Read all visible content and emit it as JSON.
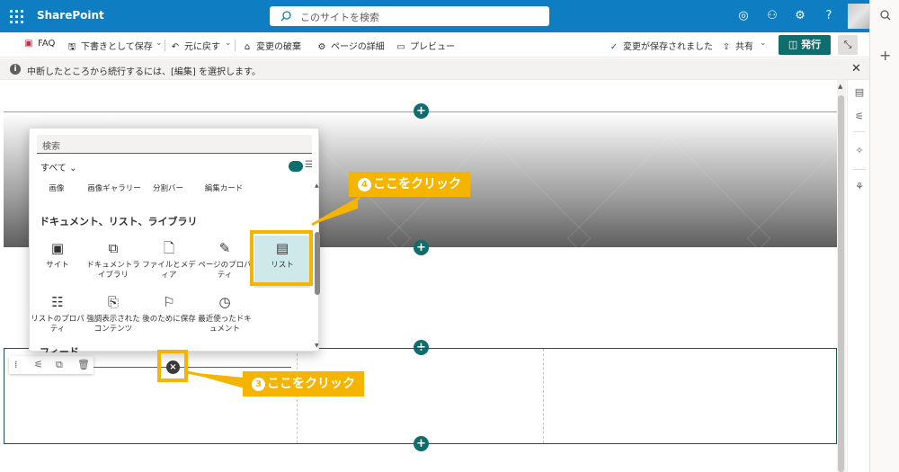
{
  "suitebar": {
    "app_title": "SharePoint",
    "search_placeholder": "このサイトを検索",
    "brand_color": "#0f7dc2"
  },
  "commandbar": {
    "faq": "FAQ",
    "save_draft": "下書きとして保存",
    "undo": "元に戻す",
    "discard": "変更の破棄",
    "page_details": "ページの詳細",
    "preview": "プレビュー",
    "saved_status": "変更が保存されました",
    "share": "共有",
    "publish": "発行",
    "publish_color": "#0e6e6e"
  },
  "infobar": {
    "message": "中断したところから続行するには、[編集] を選択します。"
  },
  "picker": {
    "search_placeholder": "検索",
    "filter_label": "すべて",
    "top_row": [
      "画像",
      "画像ギャラリー",
      "分割バー",
      "編集カード"
    ],
    "category_title": "ドキュメント、リスト、ライブラリ",
    "tiles": [
      {
        "label": "サイト",
        "icon": "site-icon"
      },
      {
        "label": "ドキュメントライブラリ",
        "icon": "document-library-icon"
      },
      {
        "label": "ファイルとメディア",
        "icon": "file-icon"
      },
      {
        "label": "ページのプロパティ",
        "icon": "page-properties-icon"
      },
      {
        "label": "リスト",
        "icon": "list-icon"
      },
      {
        "label": "リストのプロパティ",
        "icon": "list-properties-icon"
      },
      {
        "label": "強調表示されたコンテンツ",
        "icon": "highlighted-content-icon"
      },
      {
        "label": "後のために保存",
        "icon": "bookmark-icon"
      },
      {
        "label": "最近使ったドキュメント",
        "icon": "clock-icon"
      }
    ],
    "feed_title": "フィード"
  },
  "annotations": {
    "callout4": "ここをクリック",
    "callout4_num": "4",
    "callout3": "ここをクリック",
    "callout3_num": "3",
    "accent": "#f5b400"
  },
  "icons": {
    "add": "+",
    "close": "×"
  }
}
